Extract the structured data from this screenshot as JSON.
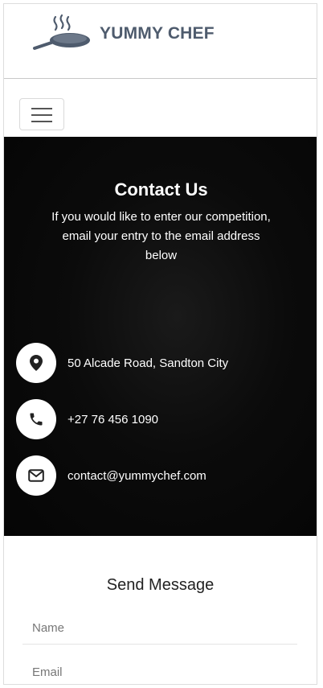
{
  "header": {
    "brand": "YUMMY CHEF"
  },
  "nav": {
    "toggler_icon": "hamburger-icon"
  },
  "contact": {
    "title": "Contact Us",
    "subtitle": "If you would like to enter our competition, email your entry to the email address below",
    "items": [
      {
        "icon": "map-pin-icon",
        "text": "50 Alcade Road, Sandton City"
      },
      {
        "icon": "phone-icon",
        "text": "+27 76 456 1090"
      },
      {
        "icon": "envelope-icon",
        "text": "contact@yummychef.com"
      }
    ]
  },
  "form": {
    "title": "Send Message",
    "name_placeholder": "Name",
    "email_placeholder": "Email"
  },
  "colors": {
    "brand_text": "#4e5b6d",
    "section_bg": "#050505",
    "icon_dark": "#222222"
  }
}
